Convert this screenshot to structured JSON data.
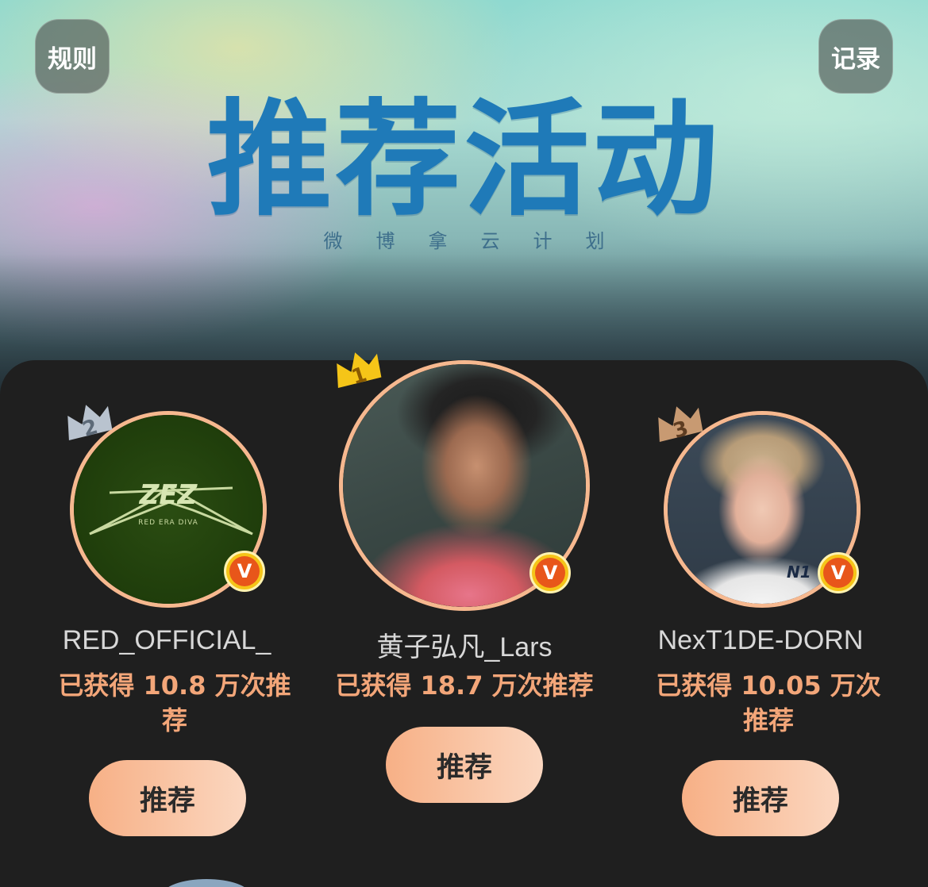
{
  "header": {
    "rules_label": "规则",
    "record_label": "记录",
    "title": "推荐活动",
    "subtitle": "微博拿云计划"
  },
  "podium": [
    {
      "rank": "2",
      "name": "RED_OFFICIAL_",
      "stat_prefix": "已获得",
      "count": "10.8",
      "stat_suffix": "万次推荐",
      "button": "推荐",
      "avatar_logo": "ZEZ",
      "avatar_caption": "RED ERA DIVA",
      "verified": "V"
    },
    {
      "rank": "1",
      "name": "黄子弘凡_Lars",
      "stat_prefix": "已获得",
      "count": "18.7",
      "stat_suffix": "万次推荐",
      "button": "推荐",
      "verified": "V"
    },
    {
      "rank": "3",
      "name": "NexT1DE-DORN",
      "stat_prefix": "已获得",
      "count": "10.05",
      "stat_suffix": "万次推荐",
      "button": "推荐",
      "verified": "V",
      "shirt_logo": "N1"
    }
  ],
  "colors": {
    "accent": "#f3a679",
    "title_blue": "#1f7ab8",
    "ring": "#f6b88f",
    "gold": "#f5c518",
    "silver": "#b9c3cf",
    "bronze": "#c89a72"
  }
}
